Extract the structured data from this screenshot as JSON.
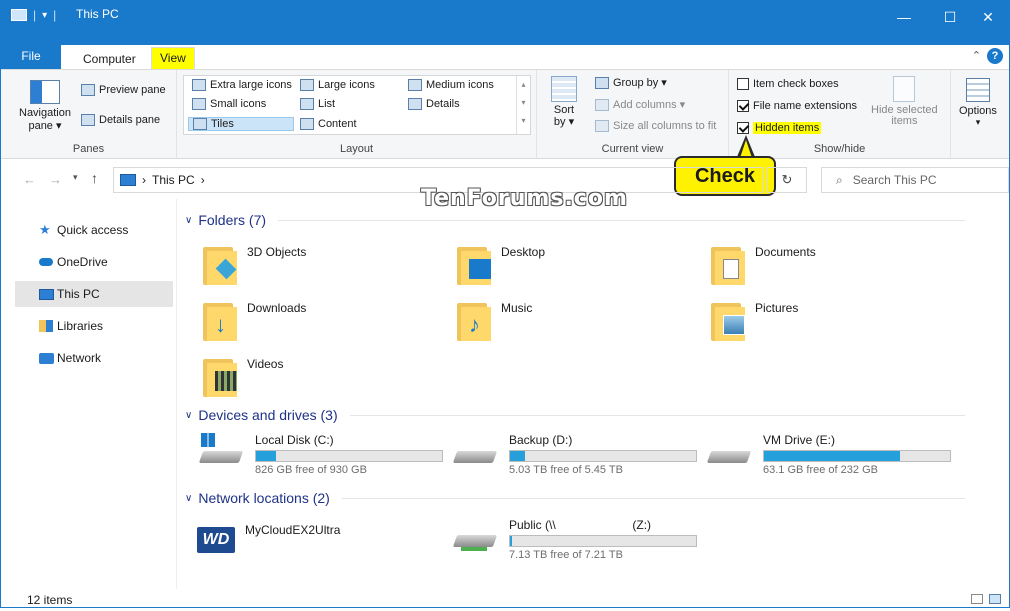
{
  "window": {
    "title": "This PC",
    "minimize": "—",
    "maximize": "☐",
    "close": "✕"
  },
  "tabs": {
    "file": "File",
    "computer": "Computer",
    "view": "View"
  },
  "ribbon": {
    "panes": {
      "label": "Panes",
      "navigation_pane": "Navigation",
      "navigation_pane2": "pane ▾",
      "preview_pane": "Preview pane",
      "details_pane": "Details pane"
    },
    "layout": {
      "label": "Layout",
      "items": [
        "Extra large icons",
        "Large icons",
        "Medium icons",
        "Small icons",
        "List",
        "Details",
        "Tiles",
        "Content"
      ],
      "selected": "Tiles"
    },
    "current_view": {
      "label": "Current view",
      "sort_by": "Sort",
      "sort_by2": "by ▾",
      "group_by": "Group by ▾",
      "add_columns": "Add columns ▾",
      "size_all_columns": "Size all columns to fit"
    },
    "show_hide": {
      "label": "Show/hide",
      "item_check_boxes": "Item check boxes",
      "file_name_extensions": "File name extensions",
      "hidden_items": "Hidden items",
      "hide_selected": "Hide selected",
      "hide_selected2": "items",
      "checks": {
        "item_check_boxes": false,
        "file_name_extensions": true,
        "hidden_items": true
      }
    },
    "options": "Options"
  },
  "address": {
    "path": "This PC",
    "search_placeholder": "Search This PC"
  },
  "callout": "Check",
  "watermark": "TenForums.com",
  "nav": [
    "Quick access",
    "OneDrive",
    "This PC",
    "Libraries",
    "Network"
  ],
  "sections": {
    "folders": "Folders (7)",
    "devices": "Devices and drives (3)",
    "network": "Network locations (2)"
  },
  "folders": [
    "3D Objects",
    "Desktop",
    "Documents",
    "Downloads",
    "Music",
    "Pictures",
    "Videos"
  ],
  "drives": [
    {
      "name": "Local Disk (C:)",
      "free": "826 GB free of 930 GB",
      "used_fraction": 0.11
    },
    {
      "name": "Backup (D:)",
      "free": "5.03 TB free of 5.45 TB",
      "used_fraction": 0.08
    },
    {
      "name": "VM Drive (E:)",
      "free": "63.1 GB free of 232 GB",
      "used_fraction": 0.73
    }
  ],
  "network": [
    {
      "name": "MyCloudEX2Ultra"
    },
    {
      "name_prefix": "Public (\\\\",
      "name_suffix": "(Z:)",
      "free": "7.13 TB free of 7.21 TB",
      "used_fraction": 0.01
    }
  ],
  "wd_logo": "WD",
  "status": {
    "items": "12 items"
  },
  "colors": {
    "titlebar": "#1979ca",
    "accent": "#26a0da",
    "highlight": "#ffff00"
  }
}
